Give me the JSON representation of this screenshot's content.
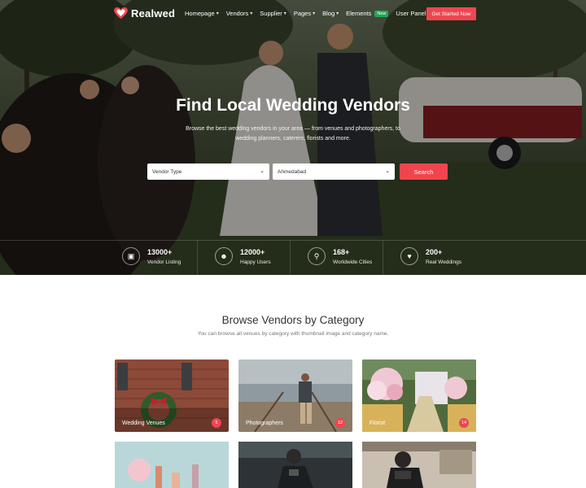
{
  "brand": {
    "name": "Realwed",
    "accent": "#f0454f"
  },
  "nav": {
    "items": [
      {
        "label": "Homepage",
        "dropdown": true
      },
      {
        "label": "Vendors",
        "dropdown": true
      },
      {
        "label": "Supplier",
        "dropdown": true
      },
      {
        "label": "Pages",
        "dropdown": true
      },
      {
        "label": "Blog",
        "dropdown": true
      },
      {
        "label": "Elements",
        "badge": "New",
        "dropdown": false
      },
      {
        "label": "User Panel",
        "dropdown": true
      }
    ],
    "cta_label": "Get Started Now"
  },
  "hero": {
    "title": "Find Local Wedding Vendors",
    "subtitle": "Browse the best wedding vendors in your area — from venues and photographers, to wedding planners, caterers, florists and more.",
    "vendor_select": "Vendor Type",
    "location_select": "Ahmedabad",
    "search_label": "Search"
  },
  "stats": [
    {
      "value": "13000+",
      "label": "Vendor Listing",
      "icon": "building-icon"
    },
    {
      "value": "12000+",
      "label": "Happy Users",
      "icon": "smile-icon"
    },
    {
      "value": "168+",
      "label": "Worldwide Cities",
      "icon": "map-pin-icon"
    },
    {
      "value": "200+",
      "label": "Real Weddings",
      "icon": "heart-icon"
    }
  ],
  "section": {
    "title": "Browse Vendors by Category",
    "subtitle": "You can browse all venues by category with thumbnail image and category name."
  },
  "categories": [
    {
      "label": "Wedding Venues",
      "count": "5"
    },
    {
      "label": "Photographers",
      "count": "12"
    },
    {
      "label": "Florist",
      "count": "14"
    }
  ]
}
